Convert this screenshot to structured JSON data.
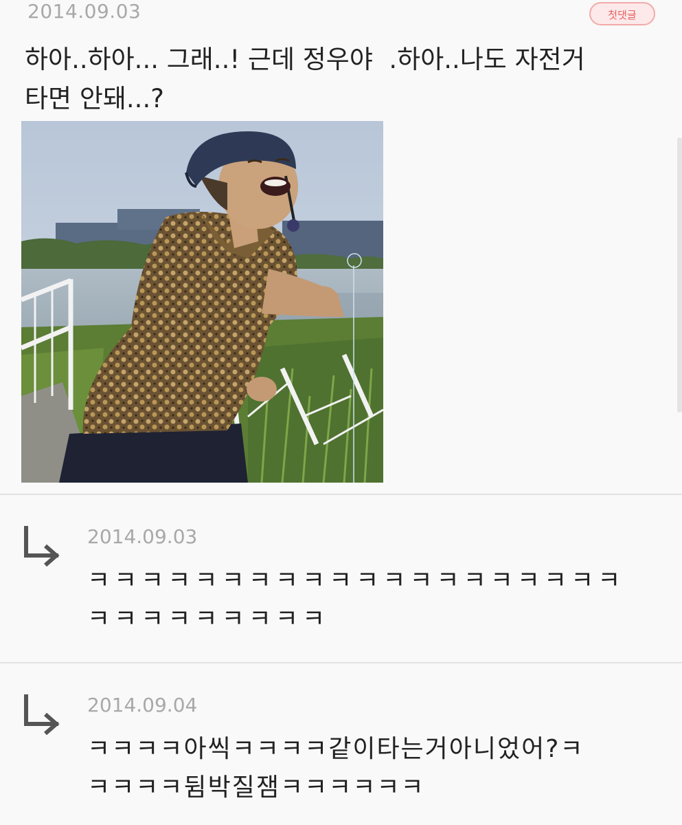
{
  "first_comment": {
    "date": "2014.09.03",
    "badge": "첫댓글",
    "text": "하아..하아... 그래..! 근데 정우야  .하아..나도 자전거\n타면 안돼...?"
  },
  "replies": [
    {
      "date": "2014.09.03",
      "text": "ㅋㅋㅋㅋㅋㅋㅋㅋㅋㅋㅋㅋㅋㅋㅋㅋㅋㅋㅋㅋ\nㅋㅋㅋㅋㅋㅋㅋㅋㅋ"
    },
    {
      "date": "2014.09.04",
      "text": "ㅋㅋㅋㅋ아씩ㅋㅋㅋㅋ같이타는거아니었어?ㅋ\nㅋㅋㅋㅋ뒴박질잼ㅋㅋㅋㅋㅋㅋ"
    }
  ],
  "icons": {
    "reply": "reply-arrow-icon"
  }
}
